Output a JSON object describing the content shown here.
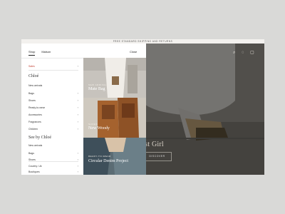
{
  "promo": "FREE STANDARD SHIPPING AND RETURNS",
  "menu": {
    "tabs": [
      "Shop",
      "Maison"
    ],
    "close_label": "Close",
    "sales_label": "Sales",
    "section1_title": "Chloé",
    "section1_items": [
      "New arrivals",
      "Bags",
      "Shoes",
      "Ready-to-wear",
      "Accessories",
      "Fragrances",
      "Children"
    ],
    "section2_title": "See by Chloé",
    "section2_items": [
      "New arrivals",
      "Bags",
      "Shoes"
    ],
    "footer_items": [
      "Country: Uk",
      "Boutiques"
    ]
  },
  "tiles": [
    {
      "kicker": "NEW ARRIVALS",
      "title": "Mate Bag"
    },
    {
      "kicker": "SHOES",
      "title": "New Woody"
    },
    {
      "kicker": "READY-TO-WEAR",
      "title": "Circular Denim Project"
    }
  ],
  "hero": {
    "title": "ts Past Girl",
    "cta": "DISCOVER"
  },
  "colors": {
    "sales": "#c23d2f",
    "overlay": "rgba(20,20,20,0.55)"
  }
}
